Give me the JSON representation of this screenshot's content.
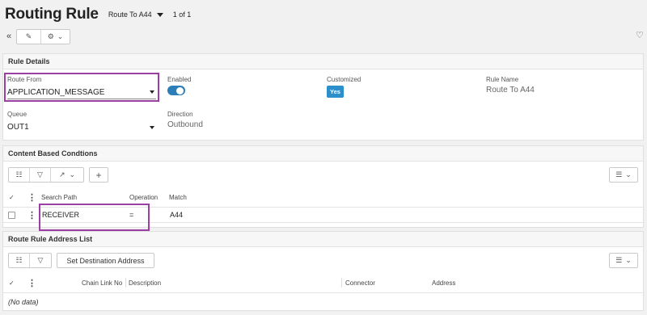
{
  "header": {
    "title": "Routing Rule",
    "record_name": "Route To A44",
    "record_count": "1 of 1"
  },
  "toolbar": {
    "collapse_icon": "«",
    "edit_icon": "✎",
    "tools_icon": "⚙",
    "tools_caret": "⌄",
    "favorite_icon": "♡"
  },
  "rule_details": {
    "title": "Rule Details",
    "route_from": {
      "label": "Route From",
      "value": "APPLICATION_MESSAGE"
    },
    "enabled": {
      "label": "Enabled",
      "on": true
    },
    "customized": {
      "label": "Customized",
      "value": "Yes"
    },
    "rule_name": {
      "label": "Rule Name",
      "value": "Route To A44"
    },
    "queue": {
      "label": "Queue",
      "value": "OUT1"
    },
    "direction": {
      "label": "Direction",
      "value": "Outbound"
    },
    "highlight_color": "#9b3fa4",
    "toggle_color": "#2c7eb8",
    "badge_color": "#2a8fca"
  },
  "conditions": {
    "title": "Content Based Condtions",
    "toolbar": {
      "list_icon": "☷",
      "filter_icon": "▽",
      "chart_icon": "↗",
      "caret_icon": "⌄",
      "add_icon": "+",
      "menu_icon": "☰",
      "menu_caret": "⌄"
    },
    "columns": {
      "check": "✓",
      "kebab": "⋮",
      "search_path": "Search Path",
      "operation": "Operation",
      "match": "Match"
    },
    "rows": [
      {
        "kebab": "⋮",
        "search_path": "RECEIVER",
        "operation": "=",
        "match": "A44"
      }
    ]
  },
  "address_list": {
    "title": "Route Rule Address List",
    "toolbar": {
      "list_icon": "☷",
      "filter_icon": "▽",
      "set_destination": "Set Destination Address",
      "menu_icon": "☰",
      "menu_caret": "⌄"
    },
    "columns": {
      "check": "✓",
      "kebab": "⋮",
      "chain_link_no": "Chain Link No",
      "description": "Description",
      "connector": "Connector",
      "address": "Address"
    },
    "empty_text": "(No data)"
  }
}
